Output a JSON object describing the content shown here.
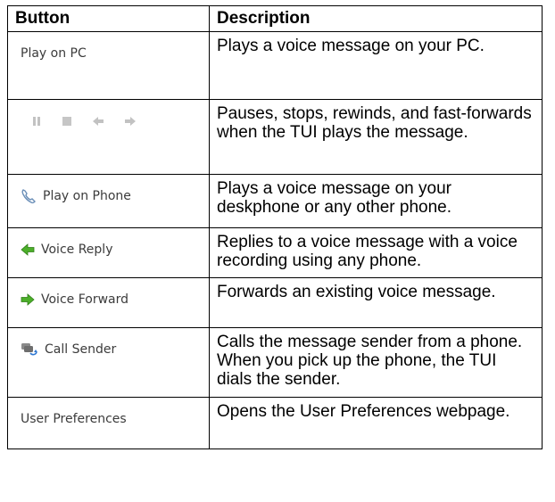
{
  "table": {
    "headers": [
      "Button",
      "Description"
    ],
    "rows": [
      {
        "button": "Play on PC",
        "description": "Plays a voice message on your PC."
      },
      {
        "button": "",
        "description": "Pauses, stops, rewinds, and fast-forwards when the TUI plays the message."
      },
      {
        "button": "Play on Phone",
        "description": "Plays a voice message on your deskphone or any other phone."
      },
      {
        "button": "Voice Reply",
        "description": "Replies to a voice message with a voice recording using any phone."
      },
      {
        "button": "Voice Forward",
        "description": "Forwards an existing voice message."
      },
      {
        "button": "Call Sender",
        "description": "Calls the message sender from a phone. When you pick up the phone, the TUI dials the sender."
      },
      {
        "button": "User Preferences",
        "description": "Opens the User Preferences webpage."
      }
    ]
  },
  "icons": {
    "playback_controls": [
      "pause-icon",
      "stop-icon",
      "rewind-icon",
      "fast-forward-icon"
    ],
    "play_on_phone": "phone-handset-icon",
    "voice_reply": "green-arrow-left-icon",
    "voice_forward": "green-arrow-right-icon",
    "call_sender": "call-sender-icon"
  },
  "colors": {
    "border": "#000000",
    "button_text": "#3b3b3b",
    "arrow_green": "#4caf2a",
    "control_gray": "#b8b8b8"
  }
}
